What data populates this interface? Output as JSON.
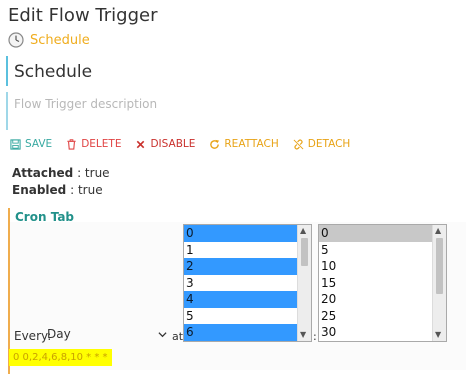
{
  "page": {
    "title": "Edit Flow Trigger"
  },
  "trigger_type": {
    "label": "Schedule",
    "icon": "clock-icon"
  },
  "form": {
    "name_value": "Schedule",
    "description_placeholder": "Flow Trigger description"
  },
  "toolbar": {
    "save_label": "SAVE",
    "delete_label": "DELETE",
    "disable_label": "DISABLE",
    "reattach_label": "REATTACH",
    "detach_label": "DETACH"
  },
  "properties": {
    "attached_label": "Attached",
    "attached_value": ": true",
    "enabled_label": "Enabled",
    "enabled_value": ": true"
  },
  "cron": {
    "title": "Cron Tab",
    "hours_list": [
      {
        "label": "0",
        "selected": true
      },
      {
        "label": "1",
        "selected": false
      },
      {
        "label": "2",
        "selected": true
      },
      {
        "label": "3",
        "selected": false
      },
      {
        "label": "4",
        "selected": true
      },
      {
        "label": "5",
        "selected": false
      },
      {
        "label": "6",
        "selected": true
      }
    ],
    "minutes_list": [
      {
        "label": "0",
        "selected": true
      },
      {
        "label": "5",
        "selected": false
      },
      {
        "label": "10",
        "selected": false
      },
      {
        "label": "15",
        "selected": false
      },
      {
        "label": "20",
        "selected": false
      },
      {
        "label": "25",
        "selected": false
      },
      {
        "label": "30",
        "selected": false
      }
    ],
    "every_label": "Every:",
    "every_value": "Day",
    "at_label": "at",
    "colon": ":",
    "expression": "0 0,2,4,6,8,10 * * *"
  },
  "colors": {
    "accent_teal": "#22918a",
    "warning_orange": "#f0ad4e",
    "danger_red": "#e04343",
    "selection_blue": "#3399ff",
    "highlight_yellow": "#ffff00"
  }
}
